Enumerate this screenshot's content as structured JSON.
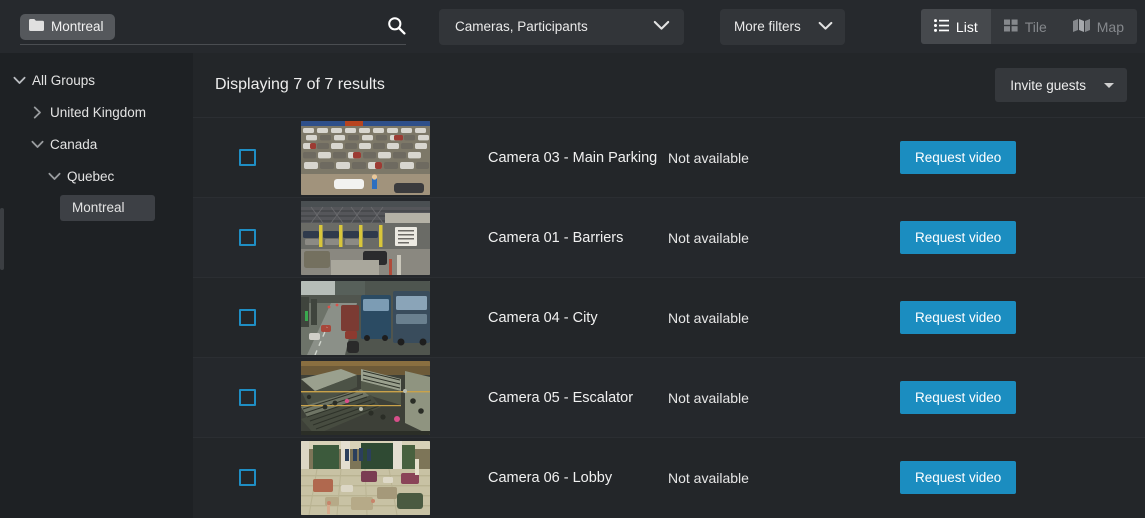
{
  "toolbar": {
    "search": {
      "chip_label": "Montreal",
      "chip_icon": "folder-icon",
      "search_icon": "search-icon",
      "placeholder": ""
    },
    "scope_dropdown": {
      "value": "Cameras, Participants",
      "icon": "chevron-down-icon"
    },
    "more_filters": {
      "label": "More filters",
      "icon": "chevron-down-icon"
    },
    "view_tabs": [
      {
        "label": "List",
        "icon": "list-view-icon",
        "active": true
      },
      {
        "label": "Tile",
        "icon": "tile-view-icon",
        "active": false
      },
      {
        "label": "Map",
        "icon": "map-view-icon",
        "active": false
      }
    ]
  },
  "sidebar": {
    "items": [
      {
        "label": "All Groups",
        "indent": 0,
        "twisty": "chevron-down-icon",
        "selected": false
      },
      {
        "label": "United Kingdom",
        "indent": 1,
        "twisty": "chevron-right-icon",
        "selected": false
      },
      {
        "label": "Canada",
        "indent": 1,
        "twisty": "chevron-down-icon",
        "selected": false
      },
      {
        "label": "Quebec",
        "indent": 2,
        "twisty": "chevron-down-icon",
        "selected": false
      },
      {
        "label": "Montreal",
        "indent": 3,
        "twisty": "none",
        "selected": true
      }
    ]
  },
  "main": {
    "results_count_text": "Displaying 7 of 7 results",
    "invite_guests": {
      "label": "Invite guests",
      "icon": "caret-down-icon"
    },
    "rows": [
      {
        "name": "Camera 03 - Main Parking",
        "status": "Not available",
        "action_label": "Request video",
        "checked": false,
        "thumbnail": "parking-lot"
      },
      {
        "name": "Camera 01 - Barriers",
        "status": "Not available",
        "action_label": "Request video",
        "checked": false,
        "thumbnail": "toll-barriers"
      },
      {
        "name": "Camera 04 - City",
        "status": "Not available",
        "action_label": "Request video",
        "checked": false,
        "thumbnail": "city-street"
      },
      {
        "name": "Camera 05 - Escalator",
        "status": "Not available",
        "action_label": "Request video",
        "checked": false,
        "thumbnail": "escalator"
      },
      {
        "name": "Camera 06 - Lobby",
        "status": "Not available",
        "action_label": "Request video",
        "checked": false,
        "thumbnail": "hotel-lobby"
      }
    ]
  },
  "colors": {
    "accent_blue": "#1b8dc0",
    "checkbox_blue": "#1f8ec4",
    "toolbar_bg": "#26292d",
    "sidebar_bg": "#1e2124",
    "main_bg": "#232629",
    "row_alt_bg": "#25282c",
    "chip_bg": "#55585c"
  }
}
